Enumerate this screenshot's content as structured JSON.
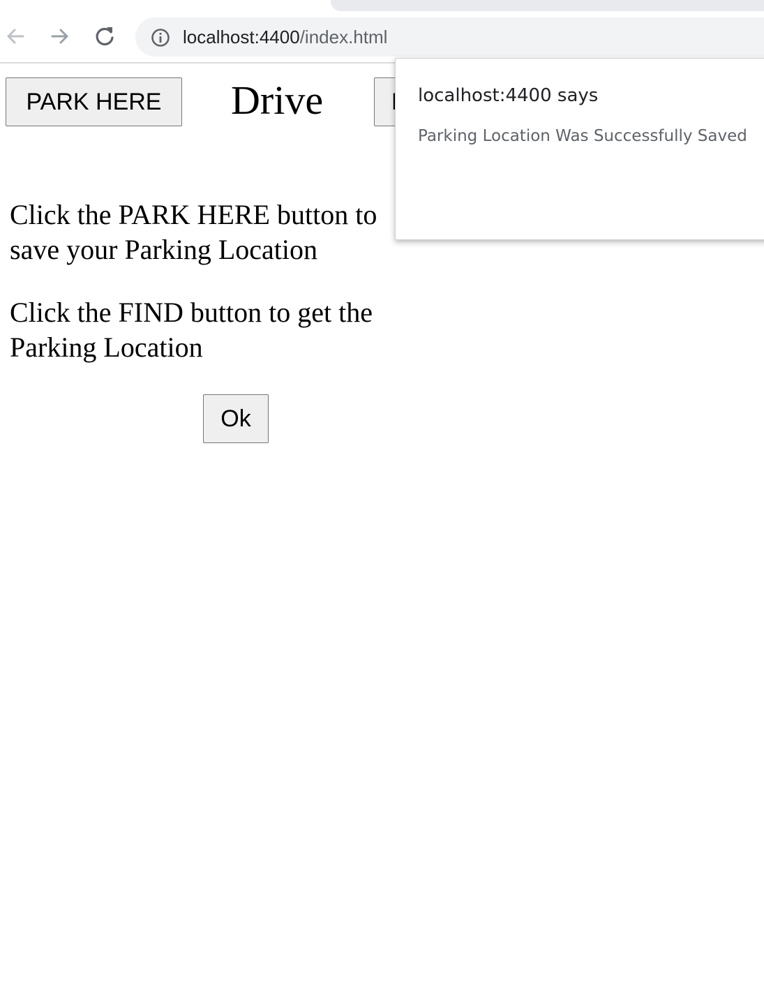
{
  "browser": {
    "url_host": "localhost:4400",
    "url_path": "/index.html",
    "icons": {
      "back": "arrow-left-icon",
      "forward": "arrow-right-icon",
      "reload": "reload-icon",
      "site_info": "info-icon"
    }
  },
  "page": {
    "park_button_label": "PARK HERE",
    "title": "Drive",
    "find_button_label": "F",
    "instruction_1": "Click the PARK HERE button to save your Parking Location",
    "instruction_2": "Click the FIND button to get the Parking Location",
    "ok_button_label": "Ok"
  },
  "dialog": {
    "title": "localhost:4400 says",
    "message": "Parking Location Was Successfully Saved"
  },
  "colors": {
    "toolbar_bg": "#ffffff",
    "omnibox_bg": "#f1f3f4",
    "button_bg": "#efefef",
    "dialog_text": "#202124",
    "dialog_message": "#5f6368"
  }
}
